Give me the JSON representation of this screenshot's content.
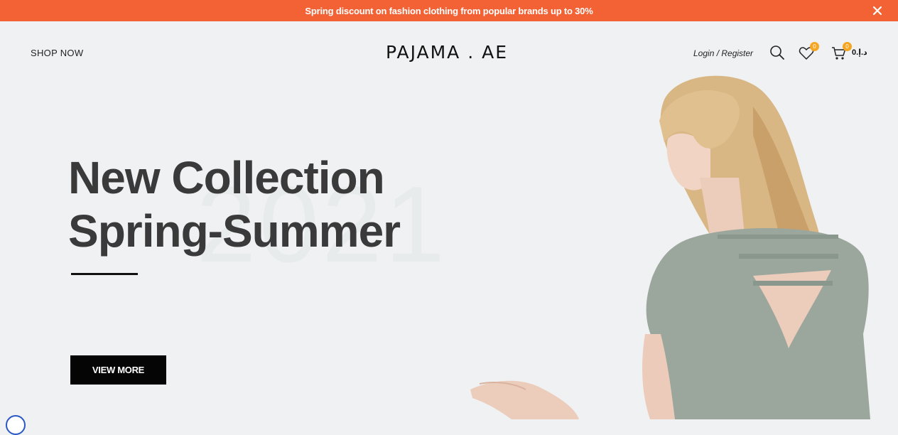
{
  "promo": {
    "text": "Spring discount on fashion clothing from popular brands up to 30%"
  },
  "header": {
    "shop_now": "SHOP NOW",
    "logo": "PAJAMA . AE",
    "login": "Login / Register",
    "wishlist_count": "0",
    "cart_count": "0",
    "cart_total": "0.د.إ"
  },
  "hero": {
    "title_line1": "New Collection",
    "title_line2": "Spring-Summer",
    "year": "2021",
    "cta": "VIEW MORE"
  },
  "colors": {
    "promo_bg": "#f26234",
    "page_bg": "#f0f1f3",
    "badge": "#f5a623",
    "button_bg": "#050505"
  },
  "icons": [
    "close-icon",
    "search-icon",
    "heart-icon",
    "cart-icon"
  ]
}
